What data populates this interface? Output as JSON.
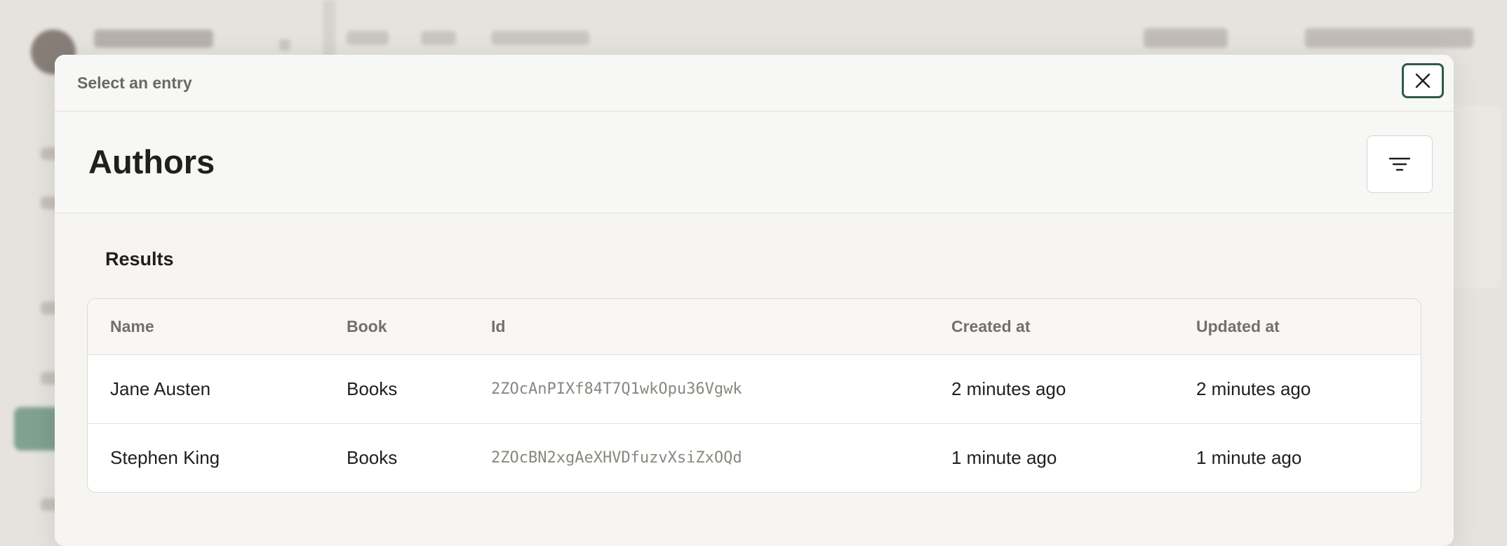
{
  "modal": {
    "title": "Select an entry",
    "close_icon": "close-icon"
  },
  "page": {
    "title": "Authors",
    "filter_icon": "filter-icon"
  },
  "results": {
    "title": "Results",
    "columns": [
      "Name",
      "Book",
      "Id",
      "Created at",
      "Updated at"
    ],
    "rows": [
      {
        "name": "Jane Austen",
        "book": "Books",
        "id": "2ZOcAnPIXf84T7Q1wkOpu36Vgwk",
        "created": "2 minutes ago",
        "updated": "2 minutes ago"
      },
      {
        "name": "Stephen King",
        "book": "Books",
        "id": "2ZOcBN2xgAeXHVDfuzvXsiZxOQd",
        "created": "1 minute ago",
        "updated": "1 minute ago"
      }
    ]
  },
  "colors": {
    "accent": "#2d5a4a",
    "background": "#e6e3de",
    "surface": "#f6f5f2"
  }
}
